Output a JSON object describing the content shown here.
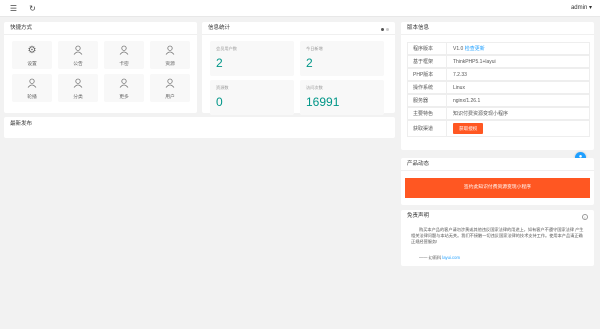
{
  "topbar": {
    "menu_icon": "menu-icon",
    "refresh_icon": "refresh-icon",
    "user_label": "admin ▾"
  },
  "quick": {
    "title": "快捷方式",
    "items": [
      {
        "label": "设置",
        "icon": "gear-icon"
      },
      {
        "label": "公告",
        "icon": "user-icon"
      },
      {
        "label": "卡密",
        "icon": "user-icon"
      },
      {
        "label": "资源",
        "icon": "user-icon"
      },
      {
        "label": "轮播",
        "icon": "user-icon"
      },
      {
        "label": "分类",
        "icon": "user-icon"
      },
      {
        "label": "更多",
        "icon": "user-icon"
      },
      {
        "label": "用户",
        "icon": "user-icon"
      }
    ]
  },
  "stats": {
    "title": "信息统计",
    "items": [
      {
        "label": "会员用户数",
        "value": "2"
      },
      {
        "label": "今日新增",
        "value": "2"
      },
      {
        "label": "资源数",
        "value": "0"
      },
      {
        "label": "访问次数",
        "value": "16991"
      }
    ],
    "dot_colors": [
      "#555555",
      "#cccccc"
    ]
  },
  "recent": {
    "title": "最新发布"
  },
  "version": {
    "title": "版本信息",
    "rows": [
      {
        "key": "程序版本",
        "value": "V1.0",
        "link": "检查更新"
      },
      {
        "key": "基于框架",
        "value": "ThinkPHP5.1+layui"
      },
      {
        "key": "PHP版本",
        "value": "7.2.33"
      },
      {
        "key": "操作系统",
        "value": "Linux"
      },
      {
        "key": "服务器",
        "value": "nginx/1.26.1"
      },
      {
        "key": "主要特色",
        "value": "知识付费资源变现小程序"
      },
      {
        "key": "获取渠道",
        "button": "获取授权"
      }
    ]
  },
  "product": {
    "title": "产品动态",
    "banner": "签约此知识付费资源变现小程序"
  },
  "disclaimer": {
    "title": "免责声明",
    "info_icon": "info-icon",
    "text": "购买本产品的客户请勿涉黄或其他违反国家法律的用途上，如有客户不遵守国家法律 产生相关法律问题与本站无关。我们不接触一切违反国家法律的技术支持工作。使用本产品请正确正规经营服务!",
    "signature_prefix": "—— 幻雨科",
    "signature_link": "layui.com"
  },
  "colors": {
    "accent": "#009688",
    "orange": "#ff5722",
    "link": "#1e9fff"
  }
}
